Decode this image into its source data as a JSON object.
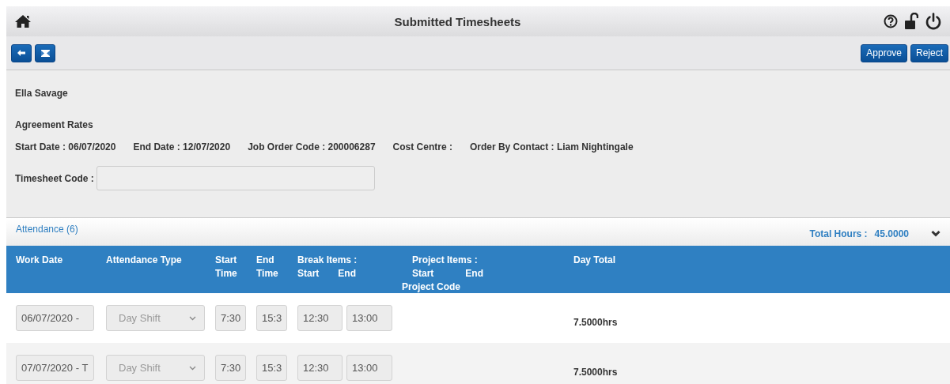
{
  "header": {
    "title": "Submitted Timesheets"
  },
  "toolbar": {
    "buttons": [
      {
        "label": "Approve"
      },
      {
        "label": "Reject"
      }
    ]
  },
  "worker": {
    "name": "Ella Savage"
  },
  "agreement": {
    "heading": "Agreement Rates",
    "details": [
      "Start Date : 06/07/2020",
      "End Date : 12/07/2020",
      "Job Order Code : 200006287",
      "Cost Centre :",
      "Order By Contact : Liam Nightingale"
    ]
  },
  "timesheet_code": {
    "label": "Timesheet Code :"
  },
  "attendance": {
    "title": "Attendance (6)",
    "total_label": "Total Hours :",
    "total_value": "45.0000",
    "expanded": true
  },
  "table": {
    "columns": [
      {
        "label": "Work Date"
      },
      {
        "label": "Attendance Type"
      },
      {
        "label": "Start Time"
      },
      {
        "label": "End Time"
      },
      {
        "label": "Break Items :",
        "sub": [
          "Start",
          "End"
        ]
      },
      {
        "label": "Project Items :",
        "sub": [
          "Start",
          "End"
        ],
        "extra": "Project Code"
      },
      {
        "label": "Day Total"
      }
    ],
    "rows": [
      {
        "work_date": "06/07/2020 -",
        "attendance_type": "Day Shift",
        "type_disabled": true,
        "start_time": "7:30",
        "end_time": "15:3",
        "break_start": "12:30",
        "break_end": "13:00",
        "day_total": "7.5000hrs"
      },
      {
        "work_date": "07/07/2020 - T",
        "attendance_type": "Day Shift",
        "type_disabled": true,
        "start_time": "7:30",
        "end_time": "15:3",
        "break_start": "12:30",
        "break_end": "13:00",
        "day_total": "7.5000hrs"
      }
    ]
  }
}
